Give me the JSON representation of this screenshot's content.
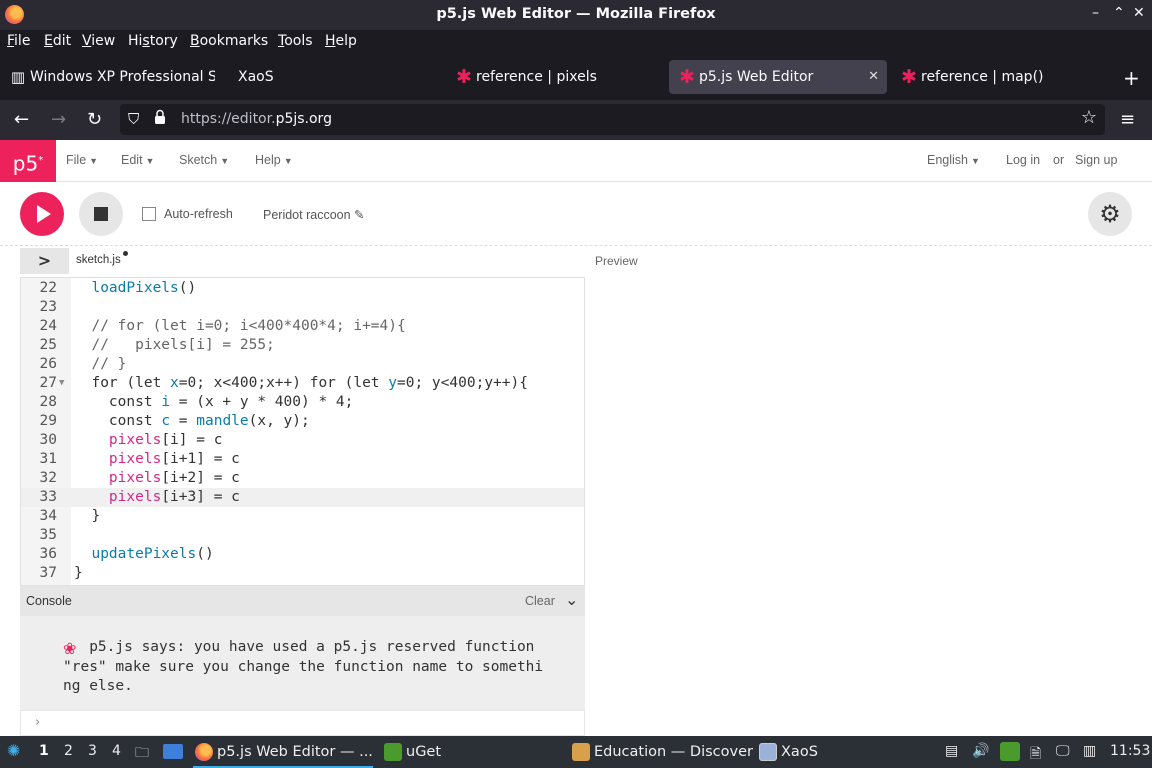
{
  "window": {
    "title": "p5.js Web Editor — Mozilla Firefox",
    "controls": [
      "–",
      "⌃",
      "✕"
    ]
  },
  "menubar": {
    "items": [
      {
        "label": "File",
        "key": "F",
        "rest": "ile"
      },
      {
        "label": "Edit",
        "key": "E",
        "rest": "dit"
      },
      {
        "label": "View",
        "key": "V",
        "rest": "iew"
      },
      {
        "label": "History",
        "key": "s",
        "pre": "Hi",
        "rest": "tory"
      },
      {
        "label": "Bookmarks",
        "key": "B",
        "rest": "ookmarks"
      },
      {
        "label": "Tools",
        "key": "T",
        "rest": "ools"
      },
      {
        "label": "Help",
        "key": "H",
        "rest": "elp"
      }
    ]
  },
  "tabs": [
    {
      "label": "Windows XP Professional S",
      "icon": "page-icon",
      "active": false
    },
    {
      "label": "XaoS",
      "icon": "none",
      "active": false
    },
    {
      "label": "reference | pixels",
      "icon": "p5-star-icon",
      "active": false
    },
    {
      "label": "p5.js Web Editor",
      "icon": "p5-star-icon",
      "active": true
    },
    {
      "label": "reference | map()",
      "icon": "p5-star-icon",
      "active": false
    }
  ],
  "navbar": {
    "url_prefix": "https://editor.",
    "url_domain": "p5js.org"
  },
  "p5nav": {
    "logo": "p5",
    "logo_sup": "*",
    "menus": [
      "File",
      "Edit",
      "Sketch",
      "Help"
    ],
    "language": "English",
    "login": "Log in",
    "or": "or",
    "signup": "Sign up"
  },
  "toolbar": {
    "auto_refresh_label": "Auto-refresh",
    "auto_refresh_checked": false,
    "sketch_name": "Peridot raccoon"
  },
  "editor": {
    "file_name": "sketch.js",
    "preview_label": "Preview",
    "lines": [
      {
        "n": "22",
        "code": "  loadPixels()"
      },
      {
        "n": "23",
        "code": ""
      },
      {
        "n": "24",
        "code": "  // for (let i=0; i<400*400*4; i+=4){"
      },
      {
        "n": "25",
        "code": "  //   pixels[i] = 255;"
      },
      {
        "n": "26",
        "code": "  // }"
      },
      {
        "n": "27",
        "code": "  for (let x=0; x<400;x++) for (let y=0; y<400;y++){"
      },
      {
        "n": "28",
        "code": "    const i = (x + y * 400) * 4;"
      },
      {
        "n": "29",
        "code": "    const c = mandle(x, y);"
      },
      {
        "n": "30",
        "code": "    pixels[i] = c"
      },
      {
        "n": "31",
        "code": "    pixels[i+1] = c"
      },
      {
        "n": "32",
        "code": "    pixels[i+2] = c"
      },
      {
        "n": "33",
        "code": "    pixels[i+3] = c"
      },
      {
        "n": "34",
        "code": "  }"
      },
      {
        "n": "35",
        "code": ""
      },
      {
        "n": "36",
        "code": "  updatePixels()"
      },
      {
        "n": "37",
        "code": "}"
      }
    ],
    "highlighted_line": "33",
    "fold_line": "27"
  },
  "console": {
    "title": "Console",
    "clear_label": "Clear",
    "message": "   p5.js says: you have used a p5.js reserved function\n\"res\" make sure you change the function name to somethi\nng else.",
    "prompt": "›"
  },
  "taskbar": {
    "workspaces": [
      "1",
      "2",
      "3",
      "4"
    ],
    "active_workspace": "1",
    "tasks": [
      {
        "label": "p5.js Web Editor — ...",
        "active": true
      },
      {
        "label": "uGet",
        "active": false
      },
      {
        "label": "Education — Discover",
        "active": false
      },
      {
        "label": "XaoS",
        "active": false
      }
    ],
    "clock": "11:53"
  },
  "colors": {
    "p5_pink": "#ed225d",
    "firefox_dark": "#1c1b22",
    "firefox_chrome": "#2b2a33"
  }
}
